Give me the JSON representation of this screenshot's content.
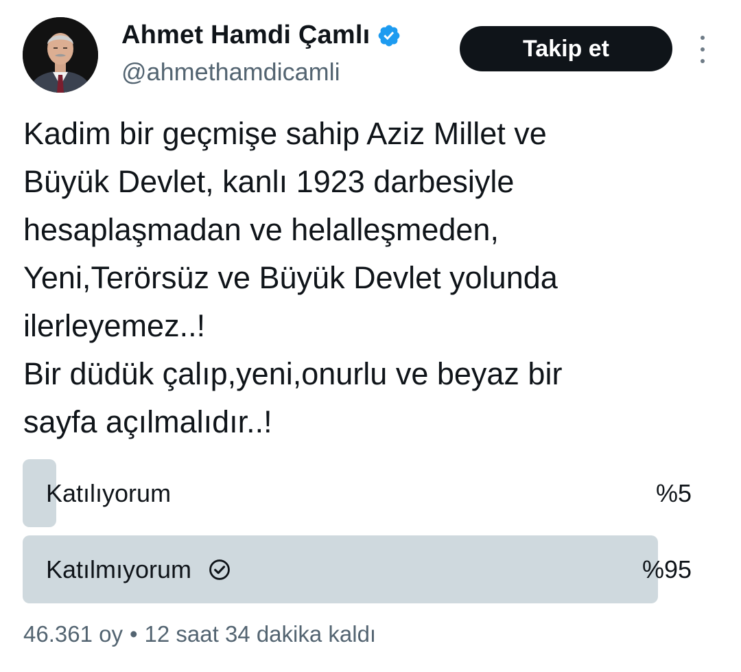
{
  "author": {
    "display_name": "Ahmet Hamdi Çamlı",
    "handle": "@ahmethamdicamli",
    "verified": true
  },
  "actions": {
    "follow_label": "Takip et",
    "more_icon": "more-vertical-icon"
  },
  "tweet": {
    "lines": [
      "Kadim bir geçmişe sahip Aziz Millet  ve",
      "Büyük Devlet, kanlı 1923 darbesiyle",
      "hesaplaşmadan ve helalleşmeden,",
      "Yeni,Terörsüz ve Büyük Devlet yolunda",
      "ilerleyemez..!",
      "Bir düdük çalıp,yeni,onurlu ve beyaz bir",
      "sayfa açılmalıdır..!"
    ]
  },
  "poll": {
    "options": [
      {
        "label": "Katılıyorum",
        "percent_label": "%5",
        "percent": 5,
        "selected": false
      },
      {
        "label": "Katılmıyorum",
        "percent_label": "%95",
        "percent": 95,
        "selected": true
      }
    ],
    "votes": "46.361 oy",
    "separator": "•",
    "time_left": "12 saat 34 dakika kaldı"
  },
  "colors": {
    "text": "#0f1419",
    "secondary": "#536471",
    "verified": "#1d9bf0",
    "poll_bar": "#cfd9de",
    "button_bg": "#0f1419"
  }
}
